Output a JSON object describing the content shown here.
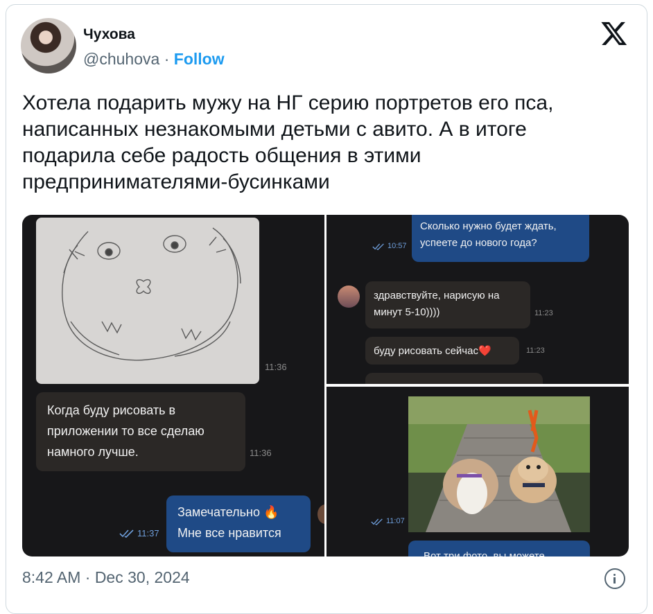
{
  "author": {
    "name": "Чухова",
    "handle": "@chuhova",
    "separator": "·",
    "follow_label": "Follow"
  },
  "tweet": {
    "text": "Хотела подарить мужу на НГ серию портретов его пса, написанных незнакомыми детьми с авито. А в итоге подарила себе радость общения в этими предпринимателями-бусинками"
  },
  "chat_left": {
    "image_time": "11:36",
    "msg1_lines": [
      "Когда буду рисовать в",
      "приложении то все сделаю",
      "намного лучше."
    ],
    "msg1_time": "11:36",
    "msg2_lines": [
      "Замечательно 🔥",
      "Мне все нравится"
    ],
    "msg2_time": "11:37"
  },
  "chat_right_top": {
    "out_lines": [
      "Сколько нужно будет ждать,",
      "успеете до нового года?"
    ],
    "out_time": "10:57",
    "in1_lines": [
      "здравствуйте, нарисую на",
      "минут 5-10))))"
    ],
    "in1_time": "11:23",
    "in2_text": "буду рисовать сейчас❤️",
    "in2_time": "11:23"
  },
  "chat_right_bottom": {
    "photo_time": "11:07",
    "cut_text": "Вот три фото, вы можете"
  },
  "footer": {
    "timestamp": "8:42 AM · Dec 30, 2024"
  },
  "icons": {
    "logo": "x-logo-icon",
    "info": "info-icon",
    "check": "double-check-icon"
  },
  "colors": {
    "follow": "#1d9bf0",
    "secondary": "#536471",
    "chat_bg": "#171719",
    "bubble_in": "#2b2826",
    "bubble_out": "#1f4a86"
  }
}
